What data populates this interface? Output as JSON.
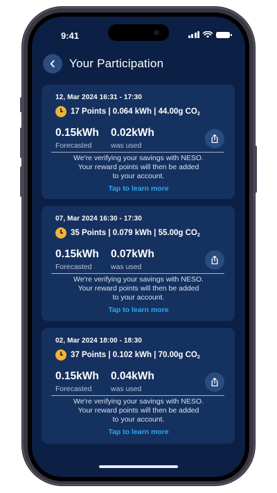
{
  "status_bar": {
    "time": "9:41"
  },
  "header": {
    "title": "Your Participation"
  },
  "colors": {
    "background": "#0c1f44",
    "card": "#15315f",
    "accent_button": "#2a4c7e",
    "link": "#2aa8f0",
    "clock_icon": "#f0b33a"
  },
  "icons": {
    "back": "chevron-left-icon",
    "points": "clock-icon",
    "share": "share-icon"
  },
  "cards": [
    {
      "date": "12, Mar 2024 16:31 - 17:30",
      "points_summary": "17 Points | 0.064 kWh | 44.00g CO",
      "co2_subscript": "2",
      "forecasted_value": "0.15kWh",
      "forecasted_label": "Forecasted",
      "used_value": "0.02kWh",
      "used_label": "was used",
      "note_line1": "We're verifying your savings with NESO.",
      "note_line2": "Your reward points will then be added",
      "note_line3": "to your account.",
      "learn_more": "Tap to learn more"
    },
    {
      "date": "07, Mar 2024 16:30 - 17:30",
      "points_summary": "35 Points | 0.079 kWh | 55.00g CO",
      "co2_subscript": "2",
      "forecasted_value": "0.15kWh",
      "forecasted_label": "Forecasted",
      "used_value": "0.07kWh",
      "used_label": "was used",
      "note_line1": "We're verifying your savings with NESO.",
      "note_line2": "Your reward points will then be added",
      "note_line3": "to your account.",
      "learn_more": "Tap to learn more"
    },
    {
      "date": "02, Mar 2024 18:00 - 18:30",
      "points_summary": "37 Points | 0.102 kWh | 70.00g CO",
      "co2_subscript": "2",
      "forecasted_value": "0.15kWh",
      "forecasted_label": "Forecasted",
      "used_value": "0.04kWh",
      "used_label": "was used",
      "note_line1": "We're verifying your savings with NESO.",
      "note_line2": "Your reward points will then be added",
      "note_line3": "to your account.",
      "learn_more": "Tap to learn more"
    }
  ]
}
